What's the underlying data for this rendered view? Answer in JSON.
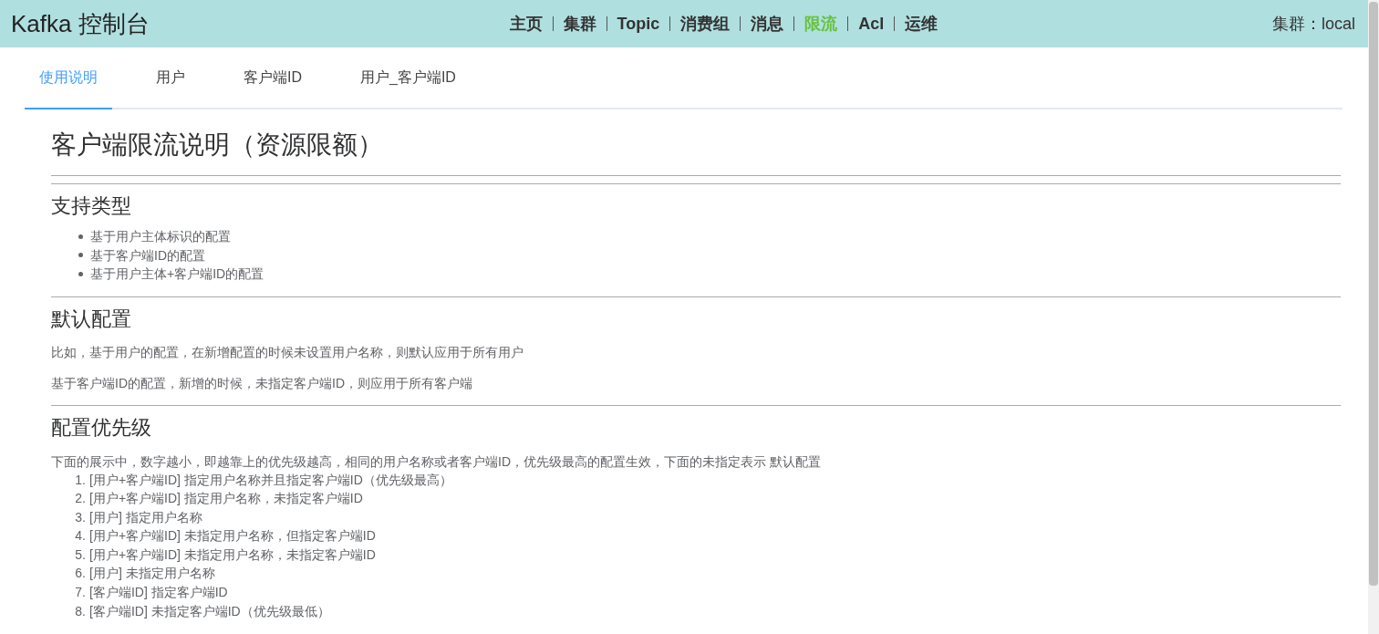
{
  "header": {
    "title": "Kafka 控制台",
    "nav": [
      {
        "label": "主页",
        "selected": false
      },
      {
        "label": "集群",
        "selected": false
      },
      {
        "label": "Topic",
        "selected": false
      },
      {
        "label": "消费组",
        "selected": false
      },
      {
        "label": "消息",
        "selected": false
      },
      {
        "label": "限流",
        "selected": true
      },
      {
        "label": "Acl",
        "selected": false
      },
      {
        "label": "运维",
        "selected": false
      }
    ],
    "cluster": "集群：local"
  },
  "tabs": [
    {
      "label": "使用说明",
      "selected": true
    },
    {
      "label": "用户",
      "selected": false
    },
    {
      "label": "客户端ID",
      "selected": false
    },
    {
      "label": "用户_客户端ID",
      "selected": false
    }
  ],
  "doc": {
    "title": "客户端限流说明（资源限额）",
    "sections": [
      {
        "heading": "支持类型",
        "blocks": [
          {
            "kind": "bullets",
            "items": [
              "基于用户主体标识的配置",
              "基于客户端ID的配置",
              "基于用户主体+客户端ID的配置"
            ]
          }
        ]
      },
      {
        "heading": "默认配置",
        "blocks": [
          {
            "kind": "paragraph",
            "text": "比如，基于用户的配置，在新增配置的时候未设置用户名称，则默认应用于所有用户"
          },
          {
            "kind": "paragraph",
            "text": "基于客户端ID的配置，新增的时候，未指定客户端ID，则应用于所有客户端"
          }
        ]
      },
      {
        "heading": "配置优先级",
        "blocks": [
          {
            "kind": "intro",
            "text": "下面的展示中，数字越小，即越靠上的优先级越高，相同的用户名称或者客户端ID，优先级最高的配置生效，下面的未指定表示 默认配置"
          },
          {
            "kind": "ordered",
            "items": [
              {
                "number": "1.",
                "text": "[用户+客户端ID] 指定用户名称并且指定客户端ID（优先级最高）"
              },
              {
                "number": "2.",
                "text": "[用户+客户端ID] 指定用户名称，未指定客户端ID"
              },
              {
                "number": "3.",
                "text": "[用户] 指定用户名称"
              },
              {
                "number": "4.",
                "text": "[用户+客户端ID] 未指定用户名称，但指定客户端ID"
              },
              {
                "number": "5.",
                "text": "[用户+客户端ID] 未指定用户名称，未指定客户端ID"
              },
              {
                "number": "6.",
                "text": "[用户] 未指定用户名称"
              },
              {
                "number": "7.",
                "text": "[客户端ID] 指定客户端ID"
              },
              {
                "number": "8.",
                "text": "[客户端ID] 未指定客户端ID（优先级最低）"
              }
            ]
          }
        ]
      }
    ]
  }
}
